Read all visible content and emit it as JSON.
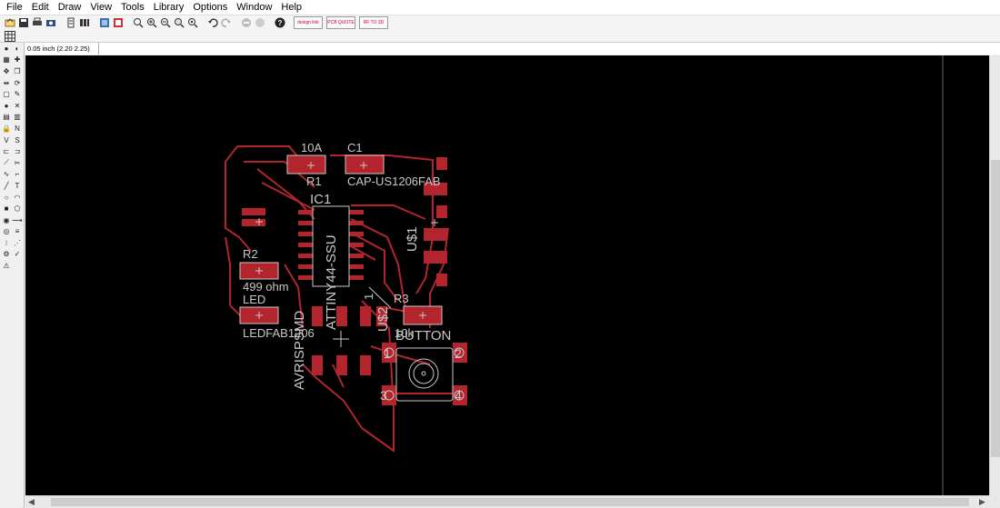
{
  "menu": [
    "File",
    "Edit",
    "Draw",
    "View",
    "Tools",
    "Library",
    "Options",
    "Window",
    "Help"
  ],
  "toolbar": {
    "buttons": [
      "open-icon",
      "save-icon",
      "print-icon",
      "cam-icon",
      "script-icon",
      "run-icon",
      "schematic-icon",
      "board-icon",
      "zoom-fit-icon",
      "zoom-in-icon",
      "zoom-out-icon",
      "zoom-select-icon",
      "redraw-icon",
      "undo-icon",
      "redo-icon",
      "stop-icon",
      "go-icon",
      "help-icon"
    ],
    "ext_buttons": [
      "design link",
      "PCB QUOTE",
      "RF TO 3D"
    ]
  },
  "command": {
    "coordinate": "0.05 inch (2.20 2.25)",
    "value": ""
  },
  "board": {
    "labels": {
      "r1_value": "10A",
      "r1_name": "R1",
      "c1_name": "C1",
      "c1_value": "CAP-US1206FAB",
      "ic1_name": "IC1",
      "ic1_value": "ATTINY44-SSU",
      "usb1": "U$1",
      "r2_name": "R2",
      "r2_value": "499 ohm",
      "led_name": "LED",
      "led_value": "LEDFAB1206",
      "avrisp": "AVRISPSMD",
      "pin1": "1",
      "u2": "U$2",
      "r3_name": "R3",
      "r3_value": "10k",
      "button": "BUTTON",
      "btn_p1": "1",
      "btn_p2": "2",
      "btn_p3": "3",
      "btn_p4": "4"
    },
    "colors": {
      "background": "#000000",
      "copper": "#b3252d",
      "silkscreen": "#c8c8c8"
    }
  }
}
